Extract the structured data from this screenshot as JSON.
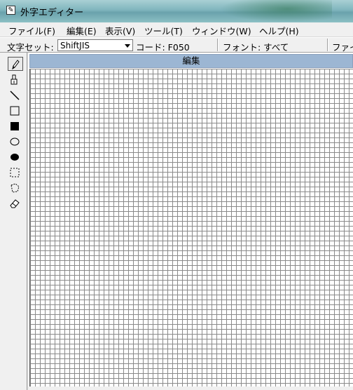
{
  "window": {
    "title": "外字エディター",
    "app_icon": "pencil-paper-icon"
  },
  "menu": [
    {
      "label": "ファイル(F)"
    },
    {
      "label": "編集(E)"
    },
    {
      "label": "表示(V)"
    },
    {
      "label": "ツール(T)"
    },
    {
      "label": "ウィンドウ(W)"
    },
    {
      "label": "ヘルプ(H)"
    }
  ],
  "toolbar": {
    "charset_label": "文字セット:",
    "charset_value": "ShiftJIS",
    "code_label": "コード: F050",
    "font_label": "フォント: すべて",
    "font_file_label": "ファイ"
  },
  "tools": [
    {
      "name": "pencil-tool",
      "icon": "pencil-icon",
      "selected": true
    },
    {
      "name": "brush-tool",
      "icon": "brush-icon",
      "selected": false
    },
    {
      "name": "line-tool",
      "icon": "line-icon",
      "selected": false
    },
    {
      "name": "hollow-rectangle-tool",
      "icon": "hollow-rectangle-icon",
      "selected": false
    },
    {
      "name": "filled-rectangle-tool",
      "icon": "filled-rectangle-icon",
      "selected": false
    },
    {
      "name": "hollow-ellipse-tool",
      "icon": "hollow-ellipse-icon",
      "selected": false
    },
    {
      "name": "filled-ellipse-tool",
      "icon": "filled-ellipse-icon",
      "selected": false
    },
    {
      "name": "rectangular-selection-tool",
      "icon": "rectangular-selection-icon",
      "selected": false
    },
    {
      "name": "freeform-selection-tool",
      "icon": "freeform-selection-icon",
      "selected": false
    },
    {
      "name": "eraser-tool",
      "icon": "eraser-icon",
      "selected": false
    }
  ],
  "edit_window": {
    "title": "編集"
  }
}
